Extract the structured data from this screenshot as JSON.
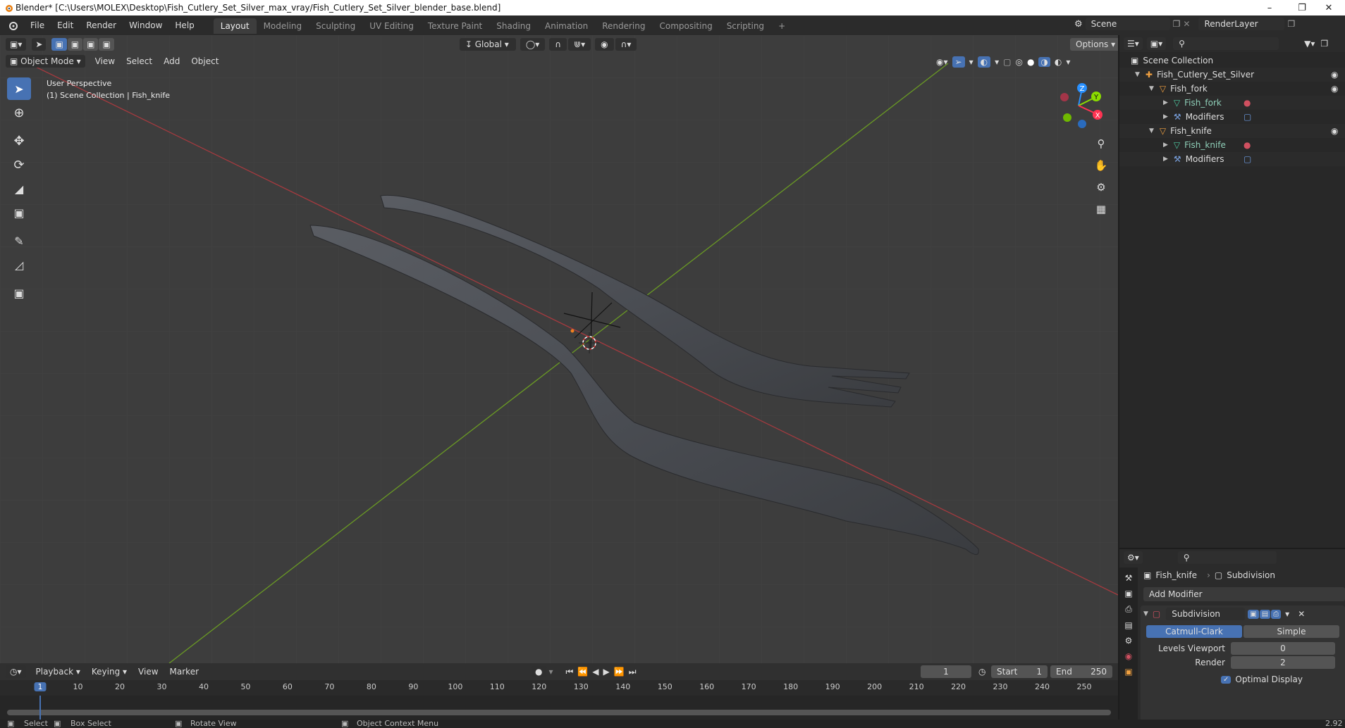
{
  "window": {
    "title": "Blender* [C:\\Users\\MOLEX\\Desktop\\Fish_Cutlery_Set_Silver_max_vray/Fish_Cutlery_Set_Silver_blender_base.blend]",
    "minimize": "–",
    "restore": "❐",
    "close": "✕"
  },
  "menu": [
    "File",
    "Edit",
    "Render",
    "Window",
    "Help"
  ],
  "workspaces": [
    {
      "label": "Layout",
      "active": true
    },
    {
      "label": "Modeling"
    },
    {
      "label": "Sculpting"
    },
    {
      "label": "UV Editing"
    },
    {
      "label": "Texture Paint"
    },
    {
      "label": "Shading"
    },
    {
      "label": "Animation"
    },
    {
      "label": "Rendering"
    },
    {
      "label": "Compositing"
    },
    {
      "label": "Scripting"
    }
  ],
  "add_workspace": "+",
  "scene": {
    "name": "Scene",
    "render_layer": "RenderLayer"
  },
  "viewport": {
    "mode": "Object Mode",
    "menus": [
      "View",
      "Select",
      "Add",
      "Object"
    ],
    "orientation": "Global",
    "options": "Options",
    "overlay_title": "User Perspective",
    "overlay_subtitle": "(1) Scene Collection | Fish_knife",
    "gizmo_labels": {
      "z": "Z",
      "y": "Y",
      "x": "X"
    }
  },
  "outliner": {
    "rows": [
      {
        "label": "Scene Collection",
        "indent": 0,
        "icon": "collection-icon"
      },
      {
        "label": "Fish_Cutlery_Set_Silver",
        "indent": 1,
        "icon": "empty-icon",
        "expanded": true
      },
      {
        "label": "Fish_fork",
        "indent": 2,
        "icon": "object-icon",
        "expanded": true
      },
      {
        "label": "Fish_fork",
        "indent": 3,
        "icon": "mesh-icon"
      },
      {
        "label": "Modifiers",
        "indent": 3,
        "icon": "wrench-icon"
      },
      {
        "label": "Fish_knife",
        "indent": 2,
        "icon": "object-icon",
        "expanded": true
      },
      {
        "label": "Fish_knife",
        "indent": 3,
        "icon": "mesh-icon"
      },
      {
        "label": "Modifiers",
        "indent": 3,
        "icon": "wrench-icon"
      }
    ]
  },
  "properties": {
    "object_name": "Fish_knife",
    "modifier_breadcrumb": "Subdivision",
    "add_modifier": "Add Modifier",
    "modifier_name": "Subdivision",
    "type_catmull": "Catmull-Clark",
    "type_simple": "Simple",
    "levels_viewport_label": "Levels Viewport",
    "levels_viewport_value": "0",
    "render_label": "Render",
    "render_value": "2",
    "optimal_display": "Optimal Display"
  },
  "timeline": {
    "menus": [
      "Playback",
      "Keying",
      "View",
      "Marker"
    ],
    "current_frame": "1",
    "start_label": "Start",
    "start_value": "1",
    "end_label": "End",
    "end_value": "250",
    "ticks": [
      "1",
      "10",
      "20",
      "30",
      "40",
      "50",
      "60",
      "70",
      "80",
      "90",
      "100",
      "110",
      "120",
      "130",
      "140",
      "150",
      "160",
      "170",
      "180",
      "190",
      "200",
      "210",
      "220",
      "230",
      "240",
      "250"
    ],
    "current": 1,
    "range_end": 250
  },
  "status": {
    "select": "Select",
    "box_select": "Box Select",
    "rotate_view": "Rotate View",
    "context_menu": "Object Context Menu",
    "version": "2.92"
  },
  "colors": {
    "accent": "#4772b3",
    "x_axis": "#ff3352",
    "y_axis": "#8bdc00",
    "z_axis": "#2890ff"
  }
}
